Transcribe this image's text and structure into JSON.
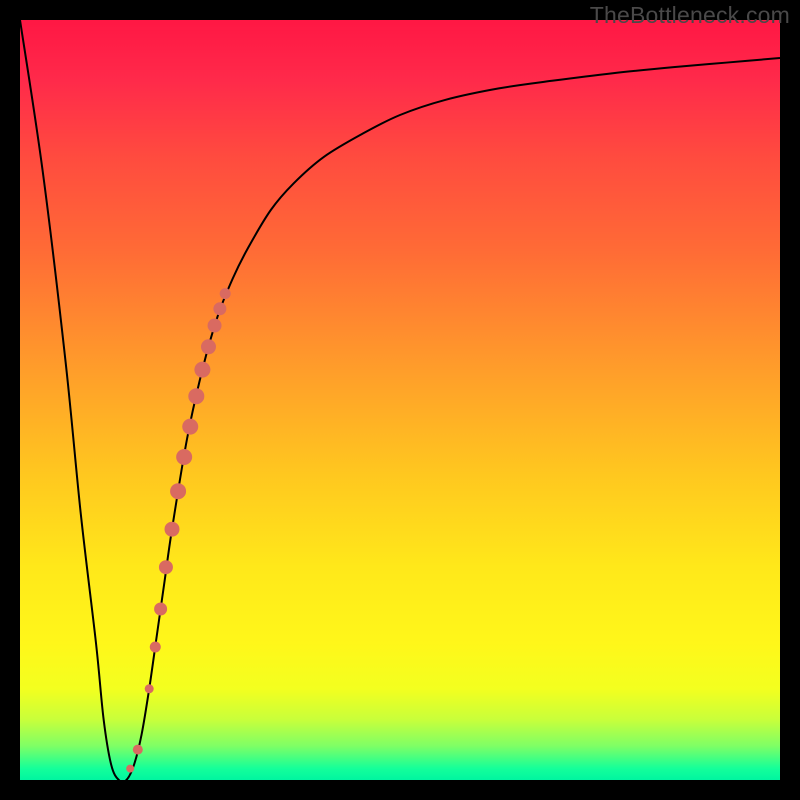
{
  "watermark": "TheBottleneck.com",
  "colors": {
    "black": "#000000",
    "curve": "#000000",
    "marker": "#d96a61",
    "gradient_stops": [
      {
        "offset": 0.0,
        "color": "#ff1744"
      },
      {
        "offset": 0.08,
        "color": "#ff2a4a"
      },
      {
        "offset": 0.18,
        "color": "#ff4b3f"
      },
      {
        "offset": 0.3,
        "color": "#ff6a36"
      },
      {
        "offset": 0.45,
        "color": "#ff9a2b"
      },
      {
        "offset": 0.6,
        "color": "#ffc81f"
      },
      {
        "offset": 0.72,
        "color": "#ffe81a"
      },
      {
        "offset": 0.82,
        "color": "#fff71a"
      },
      {
        "offset": 0.88,
        "color": "#f3ff1f"
      },
      {
        "offset": 0.92,
        "color": "#c9ff3a"
      },
      {
        "offset": 0.955,
        "color": "#7fff65"
      },
      {
        "offset": 0.985,
        "color": "#14ff9a"
      },
      {
        "offset": 1.0,
        "color": "#00f5a0"
      }
    ]
  },
  "chart_data": {
    "type": "line",
    "title": "",
    "xlabel": "",
    "ylabel": "",
    "xlim": [
      0,
      100
    ],
    "ylim": [
      0,
      100
    ],
    "curve": {
      "x": [
        0,
        3,
        6,
        8,
        10,
        11,
        12,
        13,
        14,
        15,
        16,
        17,
        18,
        19,
        20,
        22,
        24,
        26,
        28,
        30,
        33,
        36,
        40,
        45,
        50,
        56,
        63,
        70,
        78,
        86,
        93,
        100
      ],
      "y": [
        100,
        80,
        55,
        35,
        18,
        8,
        2,
        0,
        0,
        2,
        6,
        12,
        19,
        26,
        33,
        45,
        54,
        61,
        66,
        70,
        75,
        78.5,
        82,
        85,
        87.5,
        89.5,
        91,
        92,
        93,
        93.8,
        94.4,
        95
      ]
    },
    "series": [
      {
        "name": "highlighted-segment",
        "x": [
          14.5,
          15.5,
          17.0,
          17.8,
          18.5,
          19.2,
          20.0,
          20.8,
          21.6,
          22.4,
          23.2,
          24.0,
          24.8,
          25.6,
          26.3,
          27.0
        ],
        "y": [
          1.5,
          4.0,
          12.0,
          17.5,
          22.5,
          28.0,
          33.0,
          38.0,
          42.5,
          46.5,
          50.5,
          54.0,
          57.0,
          59.8,
          62.0,
          64.0
        ],
        "r": [
          4.0,
          5.0,
          4.5,
          5.5,
          6.5,
          7.0,
          7.5,
          8.0,
          8.0,
          8.0,
          8.0,
          8.0,
          7.5,
          7.0,
          6.5,
          5.5
        ]
      }
    ]
  }
}
